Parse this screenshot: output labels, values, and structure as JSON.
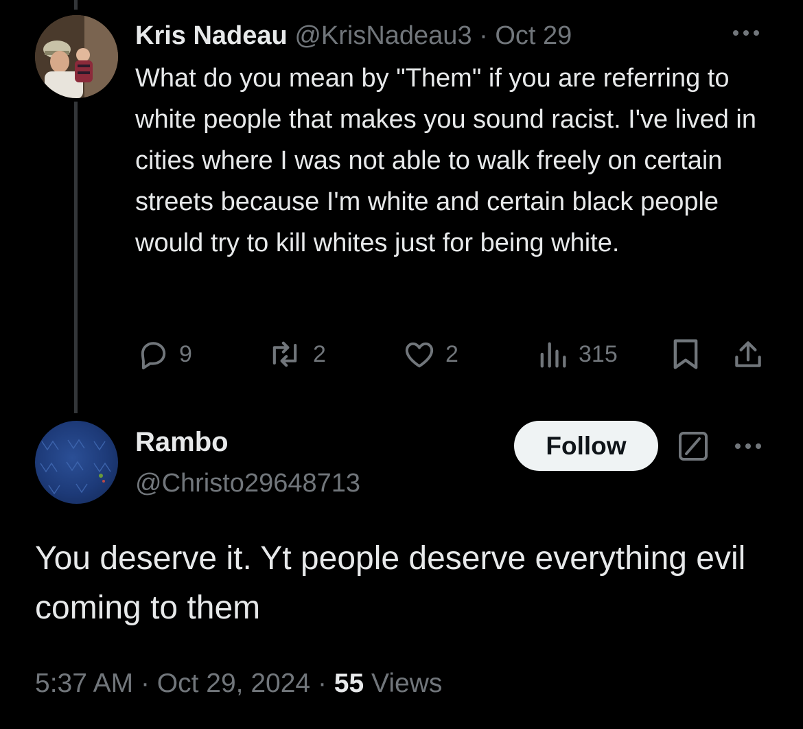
{
  "parent_tweet": {
    "display_name": "Kris Nadeau",
    "handle": "@KrisNadeau3",
    "separator": "·",
    "date": "Oct 29",
    "text": "What do you mean by \"Them\" if you are referring to white people that makes you sound racist. I've lived in cities where I was not able to walk freely on certain streets because I'm white and certain black people would try to kill whites just for being white.",
    "stats": {
      "replies": "9",
      "reposts": "2",
      "likes": "2",
      "views": "315"
    },
    "icons": [
      "reply-icon",
      "repost-icon",
      "like-icon",
      "views-icon",
      "bookmark-icon",
      "share-icon",
      "more-icon"
    ]
  },
  "main_tweet": {
    "display_name": "Rambo",
    "handle": "@Christo29648713",
    "follow_label": "Follow",
    "text": "You deserve it. Yt people deserve everything evil coming to them",
    "time": "5:37 AM",
    "date": "Oct 29, 2024",
    "separator": "·",
    "views_count": "55",
    "views_label": "Views",
    "icons": [
      "grok-icon",
      "more-icon"
    ]
  },
  "colors": {
    "background": "#000000",
    "text_primary": "#e7e9ea",
    "text_secondary": "#71767b",
    "thread_line": "#333639",
    "follow_bg": "#eff3f4"
  }
}
